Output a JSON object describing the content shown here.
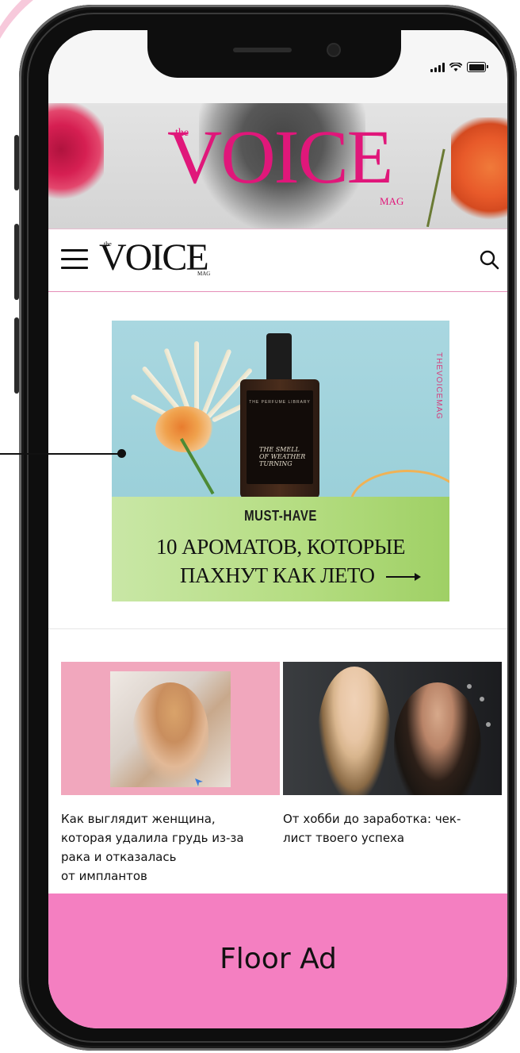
{
  "hero": {
    "brand_prefix": "the",
    "brand_title": "VOICE",
    "brand_suffix": "MAG"
  },
  "header": {
    "logo_prefix": "the",
    "logo_text": "VOICE",
    "logo_suffix": "MAG"
  },
  "promo": {
    "side_text": "THEVOICEMAG",
    "bottle_brand": "THE PERFUME LIBRARY",
    "bottle_script": "THE SMELL\nOF WEATHER\nTURNING",
    "kicker": "MUST-HAVE",
    "headline_line1": "10 АРОМАТОВ, КОТОРЫЕ",
    "headline_line2": "ПАХНУТ КАК ЛЕТО"
  },
  "articles": [
    {
      "title": "Как выглядит женщина,\nкоторая удалила грудь из-за\nрака и отказалась\nот имплантов"
    },
    {
      "title": "От хобби до заработка: чек-\nлист твоего успеха"
    }
  ],
  "floor_ad": {
    "label": "Floor Ad"
  },
  "colors": {
    "brand_pink": "#e0177a",
    "floor_ad_bg": "#f47fc1",
    "promo_green": "#b5dd82"
  }
}
